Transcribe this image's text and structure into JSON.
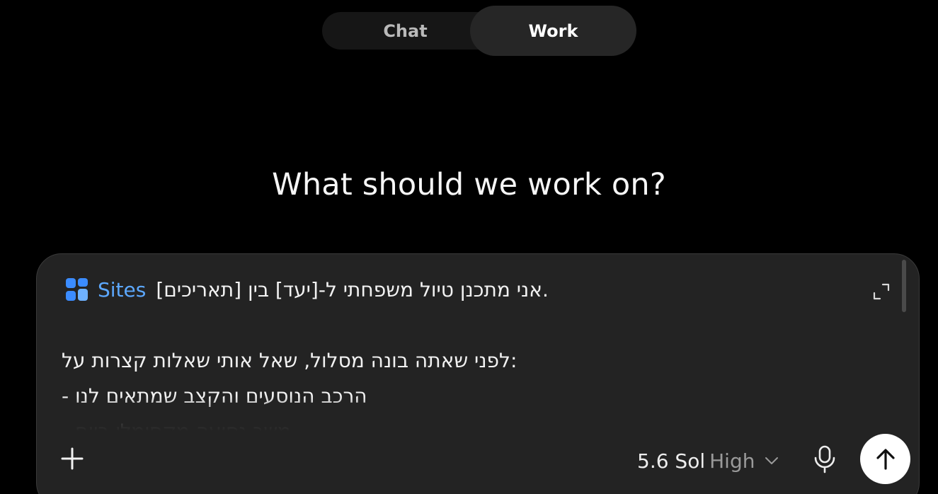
{
  "mode_switch": {
    "tabs": [
      {
        "label": "Chat",
        "active": false
      },
      {
        "label": "Work",
        "active": true
      }
    ]
  },
  "heading": "What should we work on?",
  "composer": {
    "tag": {
      "label": "Sites",
      "icon": "sites-icon",
      "color": "#5ca8ff"
    },
    "lines": [
      "אני מתכנן טיול משפחתי ל-[יעד] בין [תאריכים].",
      "",
      "לפני שאתה בונה מסלול, שאל אותי שאלות קצרות על:",
      "- הרכב הנוסעים והקצב שמתאים לנו",
      "- משך נסיעה מקסימלי ביום"
    ],
    "model": {
      "name": "5.6 Sol",
      "effort": "High"
    },
    "icons": {
      "add": "plus-icon",
      "expand": "expand-icon",
      "dropdown": "chevron-down-icon",
      "mic": "microphone-icon",
      "send": "arrow-up-icon"
    }
  }
}
